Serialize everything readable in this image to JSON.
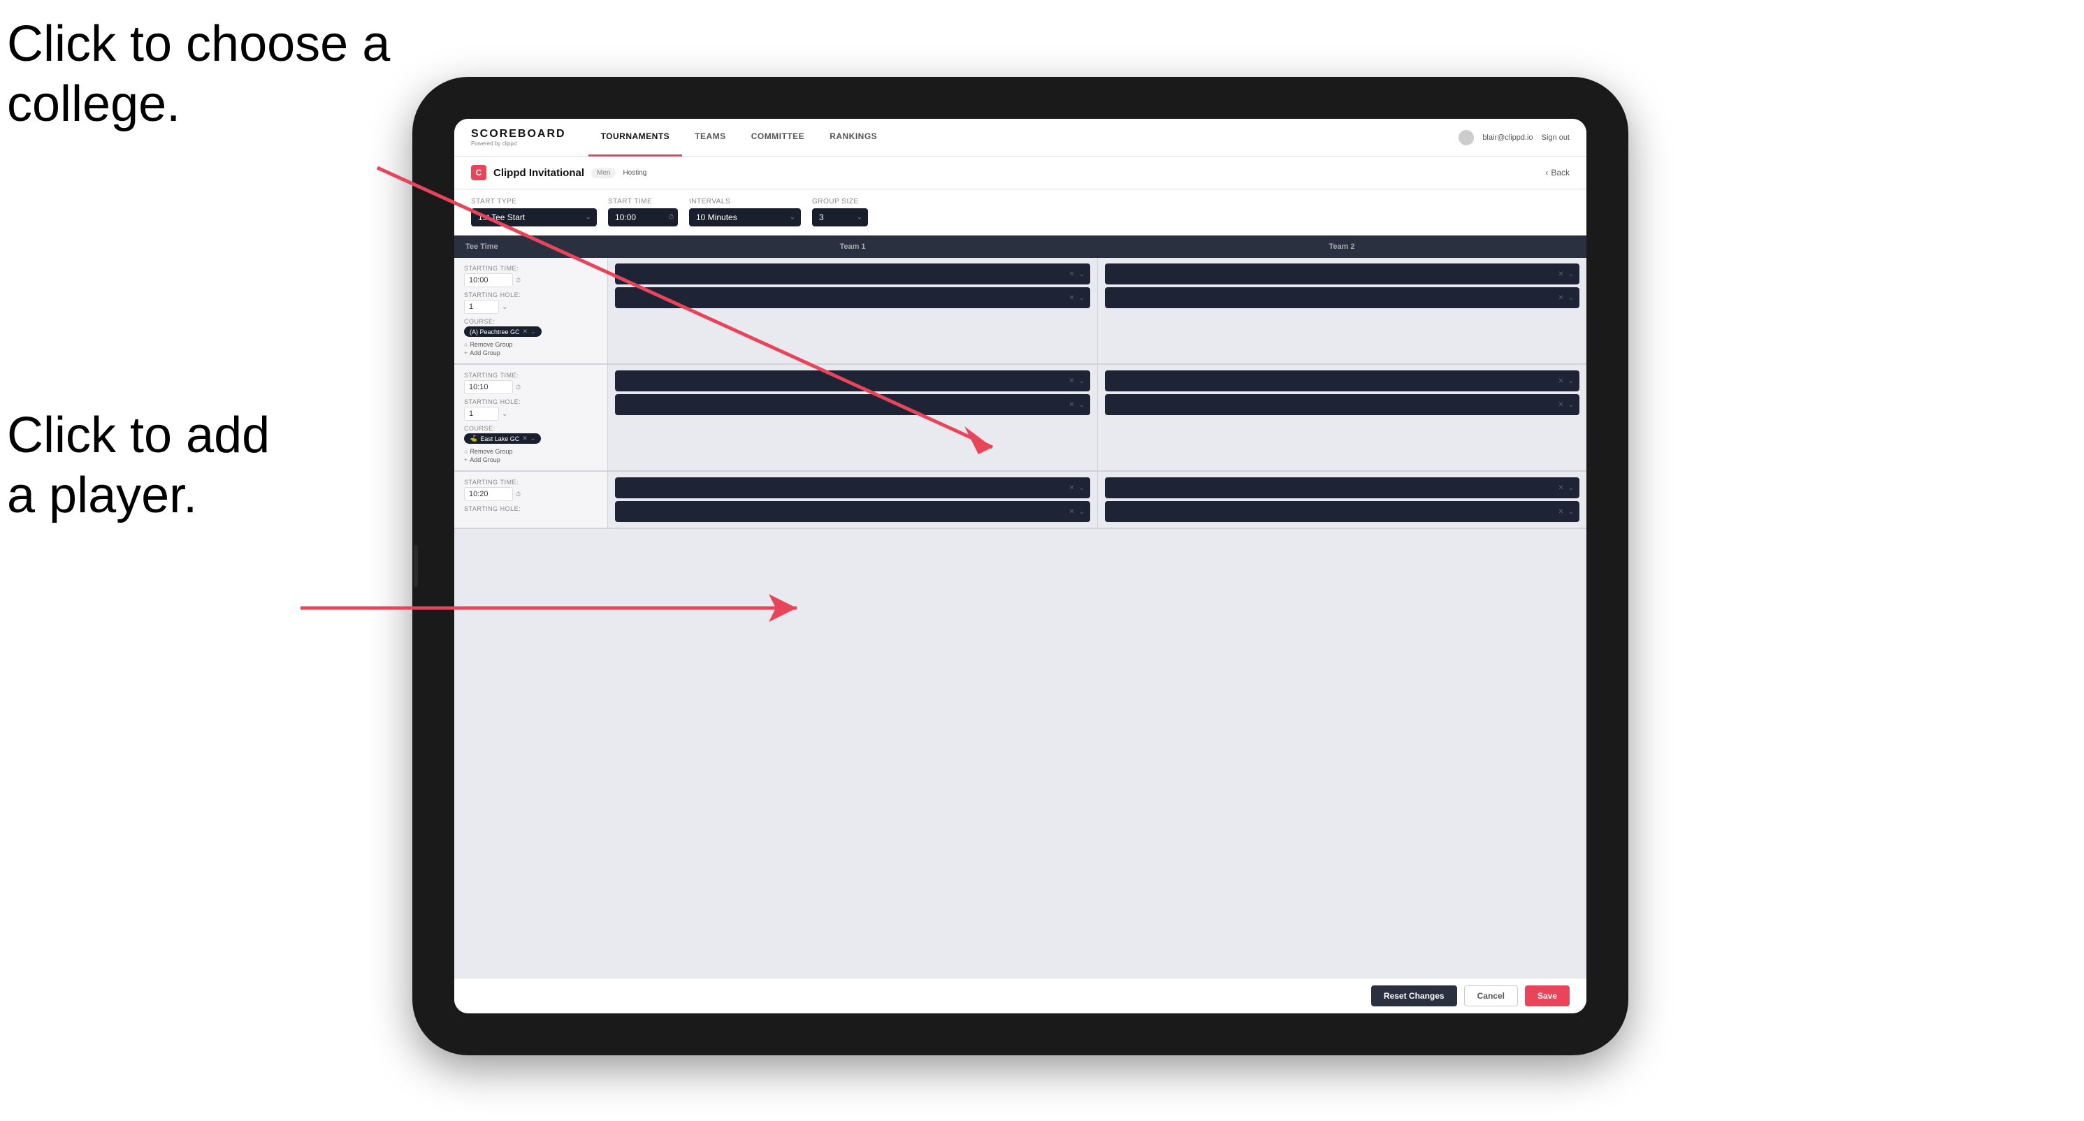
{
  "annotations": {
    "top": {
      "line1": "Click to choose a",
      "line2": "college."
    },
    "bottom": {
      "line1": "Click to add",
      "line2": "a player."
    }
  },
  "nav": {
    "logo": "SCOREBOARD",
    "logo_sub": "Powered by clippd",
    "tabs": [
      {
        "label": "Tournaments",
        "active": true
      },
      {
        "label": "Teams",
        "active": false
      },
      {
        "label": "Committee",
        "active": false
      },
      {
        "label": "Rankings",
        "active": false
      }
    ],
    "user_email": "blair@clippd.io",
    "sign_out": "Sign out"
  },
  "sub_header": {
    "event_name": "Clippd Invitational",
    "event_type": "Men",
    "hosting": "Hosting",
    "back": "Back"
  },
  "form": {
    "start_type_label": "Start Type",
    "start_type_value": "1st Tee Start",
    "start_time_label": "Start Time",
    "start_time_value": "10:00",
    "intervals_label": "Intervals",
    "intervals_value": "10 Minutes",
    "group_size_label": "Group Size",
    "group_size_value": "3"
  },
  "table": {
    "col_tee_time": "Tee Time",
    "col_team1": "Team 1",
    "col_team2": "Team 2"
  },
  "groups": [
    {
      "starting_time": "10:00",
      "starting_hole": "1",
      "course": "(A) Peachtree GC",
      "team1_slots": 2,
      "team2_slots": 2
    },
    {
      "starting_time": "10:10",
      "starting_hole": "1",
      "course": "East Lake GC",
      "team1_slots": 2,
      "team2_slots": 2
    },
    {
      "starting_time": "10:20",
      "starting_hole": "",
      "course": "",
      "team1_slots": 2,
      "team2_slots": 2
    }
  ],
  "actions": {
    "reset": "Reset Changes",
    "cancel": "Cancel",
    "save": "Save"
  },
  "group_labels": {
    "starting_time": "STARTING TIME:",
    "starting_hole": "STARTING HOLE:",
    "course": "COURSE:",
    "remove_group": "Remove Group",
    "add_group": "Add Group"
  }
}
